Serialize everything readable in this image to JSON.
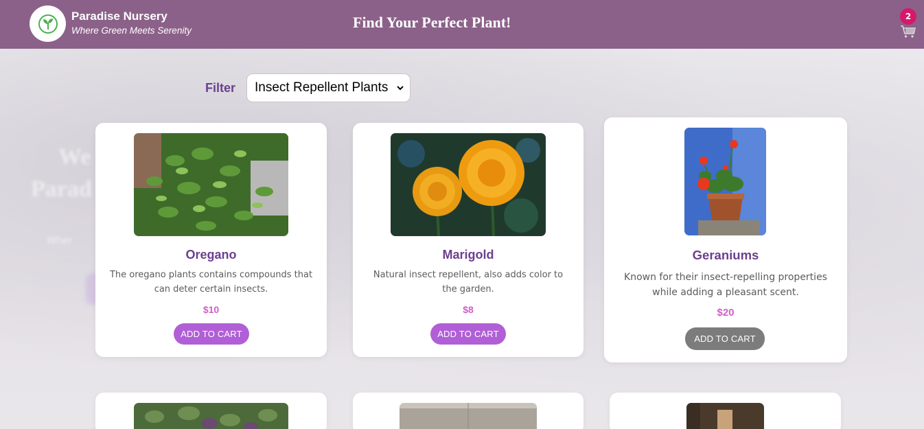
{
  "header": {
    "brand_name": "Paradise Nursery",
    "brand_tagline": "Where Green Meets Serenity",
    "title": "Find Your Perfect Plant!",
    "cart_count": "2",
    "bg_color": "#8b6189"
  },
  "filter": {
    "label": "Filter",
    "selected": "Insect Repellent Plants"
  },
  "background_text": {
    "line1": "We",
    "line2": "Parad",
    "small": "Wher"
  },
  "products": [
    {
      "name": "Oregano",
      "description": "The oregano plants contains compounds that can deter certain insects.",
      "price": "$10",
      "button": "ADD TO CART"
    },
    {
      "name": "Marigold",
      "description": "Natural insect repellent, also adds color to the garden.",
      "price": "$8",
      "button": "ADD TO CART"
    },
    {
      "name": "Geraniums",
      "description": "Known for their insect-repelling properties while adding a pleasant scent.",
      "price": "$20",
      "button": "ADD TO CART"
    }
  ],
  "colors": {
    "accent": "#b05fd6",
    "title_purple": "#6b3f8f",
    "price_pink": "#d15ec7",
    "added_button": "#7c7c7c",
    "badge": "#d6186a"
  }
}
